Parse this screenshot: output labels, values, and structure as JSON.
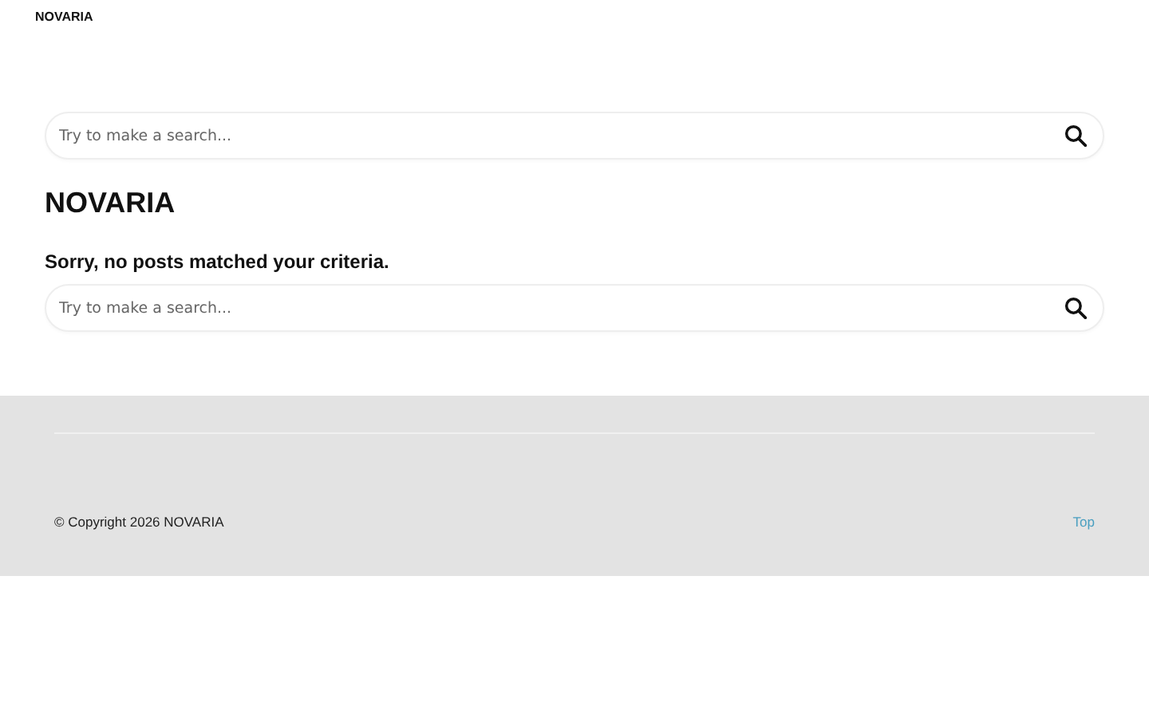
{
  "header": {
    "logo": "NOVARIA"
  },
  "top_search": {
    "placeholder": "Try to make a search..."
  },
  "page_title": "NOVARIA",
  "message": "Sorry, no posts matched your criteria.",
  "bottom_search": {
    "placeholder": "Try to make a search..."
  },
  "footer": {
    "copyright": "© Copyright 2026 NOVARIA",
    "top_link": "Top"
  }
}
